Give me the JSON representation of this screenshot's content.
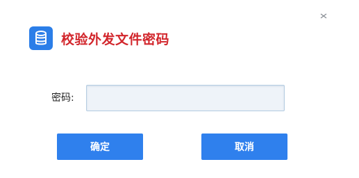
{
  "dialog": {
    "title": "校验外发文件密码",
    "title_color": "#d2262c",
    "icon": "database-icon",
    "close_icon": "close-icon",
    "accent_color": "#2f80ed"
  },
  "form": {
    "password_label": "密码:",
    "password_value": "",
    "password_placeholder": ""
  },
  "buttons": {
    "confirm_label": "确定",
    "cancel_label": "取消"
  }
}
